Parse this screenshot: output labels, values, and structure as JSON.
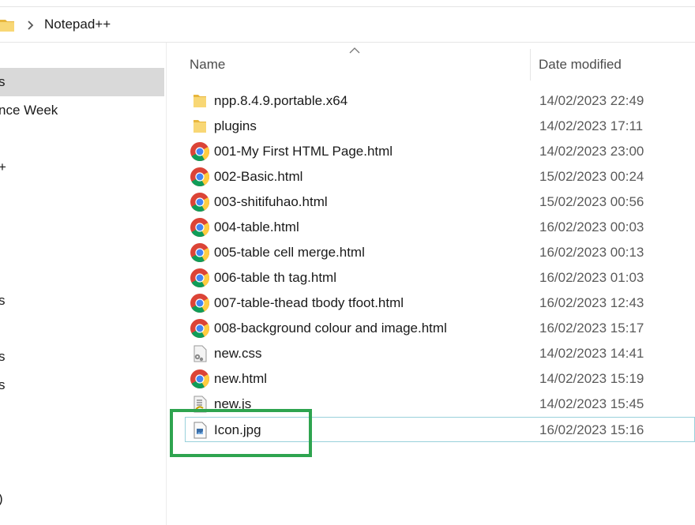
{
  "window": {
    "breadcrumb": [
      "Notepad++"
    ],
    "colors": {
      "selected_nav": "#d9d9d9",
      "highlight_box": "#2ea44f",
      "focus_border": "#99d1db"
    }
  },
  "sidebar": {
    "items": [
      {
        "label": "s",
        "selected": true
      },
      {
        "label": "nce Week"
      },
      {
        "label": "+"
      },
      {
        "label": "s"
      },
      {
        "label": "s"
      },
      {
        "label": "s"
      },
      {
        "label": ")"
      }
    ]
  },
  "columns": {
    "name": "Name",
    "date_modified": "Date modified"
  },
  "files": [
    {
      "name": "npp.8.4.9.portable.x64",
      "date": "14/02/2023 22:49",
      "icon": "folder-icon"
    },
    {
      "name": "plugins",
      "date": "14/02/2023 17:11",
      "icon": "folder-icon"
    },
    {
      "name": "001-My First HTML Page.html",
      "date": "14/02/2023 23:00",
      "icon": "chrome-icon"
    },
    {
      "name": "002-Basic.html",
      "date": "15/02/2023 00:24",
      "icon": "chrome-icon"
    },
    {
      "name": "003-shitifuhao.html",
      "date": "15/02/2023 00:56",
      "icon": "chrome-icon"
    },
    {
      "name": "004-table.html",
      "date": "16/02/2023 00:03",
      "icon": "chrome-icon"
    },
    {
      "name": "005-table cell merge.html",
      "date": "16/02/2023 00:13",
      "icon": "chrome-icon"
    },
    {
      "name": "006-table th tag.html",
      "date": "16/02/2023 01:03",
      "icon": "chrome-icon"
    },
    {
      "name": "007-table-thead tbody tfoot.html",
      "date": "16/02/2023 12:43",
      "icon": "chrome-icon"
    },
    {
      "name": "008-background colour and image.html",
      "date": "16/02/2023 15:17",
      "icon": "chrome-icon"
    },
    {
      "name": "new.css",
      "date": "14/02/2023 14:41",
      "icon": "css-file-icon"
    },
    {
      "name": "new.html",
      "date": "14/02/2023 15:19",
      "icon": "chrome-icon"
    },
    {
      "name": "new.js",
      "date": "14/02/2023 15:45",
      "icon": "js-file-icon"
    },
    {
      "name": "Icon.jpg",
      "date": "16/02/2023 15:16",
      "icon": "image-file-icon",
      "focused": true
    }
  ]
}
